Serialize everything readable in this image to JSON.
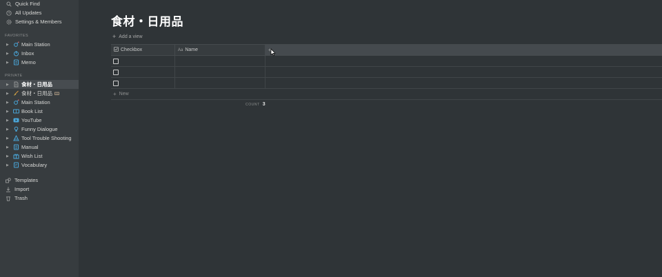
{
  "sidebar": {
    "top_items": [
      {
        "label": "Quick Find",
        "icon": "search-icon"
      },
      {
        "label": "All Updates",
        "icon": "clock-icon"
      },
      {
        "label": "Settings & Members",
        "icon": "gear-icon"
      }
    ],
    "favorites_label": "FAVORITES",
    "favorites": [
      {
        "label": "Main Station",
        "icon": "satellite-icon"
      },
      {
        "label": "Inbox",
        "icon": "inbox-icon"
      },
      {
        "label": "Memo",
        "icon": "memo-icon"
      }
    ],
    "private_label": "PRIVATE",
    "private": [
      {
        "label": "食材・日用品",
        "icon": "page-icon",
        "active": true
      },
      {
        "label": "食材・日用品",
        "icon": "broom-icon",
        "suffix_icon": "basket-icon"
      },
      {
        "label": "Main Station",
        "icon": "satellite-icon"
      },
      {
        "label": "Book List",
        "icon": "book-icon"
      },
      {
        "label": "YouTube",
        "icon": "youtube-icon"
      },
      {
        "label": "Funny Dialogue",
        "icon": "bulb-icon"
      },
      {
        "label": "Tool Trouble Shooting",
        "icon": "tools-icon"
      },
      {
        "label": "Manual",
        "icon": "manual-icon"
      },
      {
        "label": "Wish List",
        "icon": "gift-icon"
      },
      {
        "label": "Vocabulary",
        "icon": "vocab-icon"
      }
    ],
    "bottom_items": [
      {
        "label": "Templates",
        "icon": "templates-icon"
      },
      {
        "label": "Import",
        "icon": "import-icon"
      },
      {
        "label": "Trash",
        "icon": "trash-icon"
      }
    ]
  },
  "main": {
    "title": "食材・日用品",
    "add_view_label": "Add a view",
    "table": {
      "columns": [
        {
          "label": "Checkbox",
          "icon": "checkbox-icon"
        },
        {
          "label": "Name",
          "icon": "text-icon"
        }
      ],
      "add_column_label": "+",
      "rows": [
        {
          "checked": false,
          "name": ""
        },
        {
          "checked": false,
          "name": ""
        },
        {
          "checked": false,
          "name": ""
        }
      ],
      "new_label": "New",
      "count_label": "COUNT",
      "count_value": "3"
    }
  },
  "colors": {
    "sidebar_bg": "#373c3f",
    "main_bg": "#2f3437",
    "active_item_bg": "#474c50",
    "accent_icon": "#4aa6d9"
  }
}
